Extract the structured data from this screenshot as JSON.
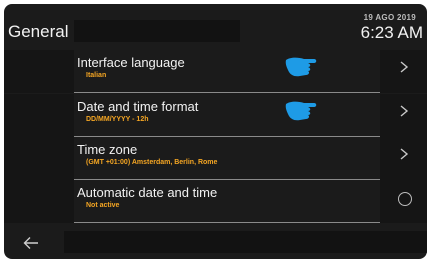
{
  "header": {
    "title": "General",
    "date": "19 AGO 2019",
    "time": "6:23 AM"
  },
  "settings": [
    {
      "label": "Interface language",
      "value": "Italian",
      "control": "chevron-right-icon"
    },
    {
      "label": "Date and time format",
      "value": "DD/MM/YYYY - 12h",
      "control": "chevron-right-icon"
    },
    {
      "label": "Time zone",
      "value": "(GMT +01:00) Amsterdam, Berlin, Rome",
      "control": "chevron-right-icon"
    },
    {
      "label": "Automatic date and time",
      "value": "Not active",
      "control": "toggle-off"
    }
  ],
  "footer": {
    "back_icon": "back-arrow-icon"
  },
  "colors": {
    "background": "#1b1b1b",
    "value_text": "#f5a623",
    "pointer_hand": "#1e9be6"
  }
}
